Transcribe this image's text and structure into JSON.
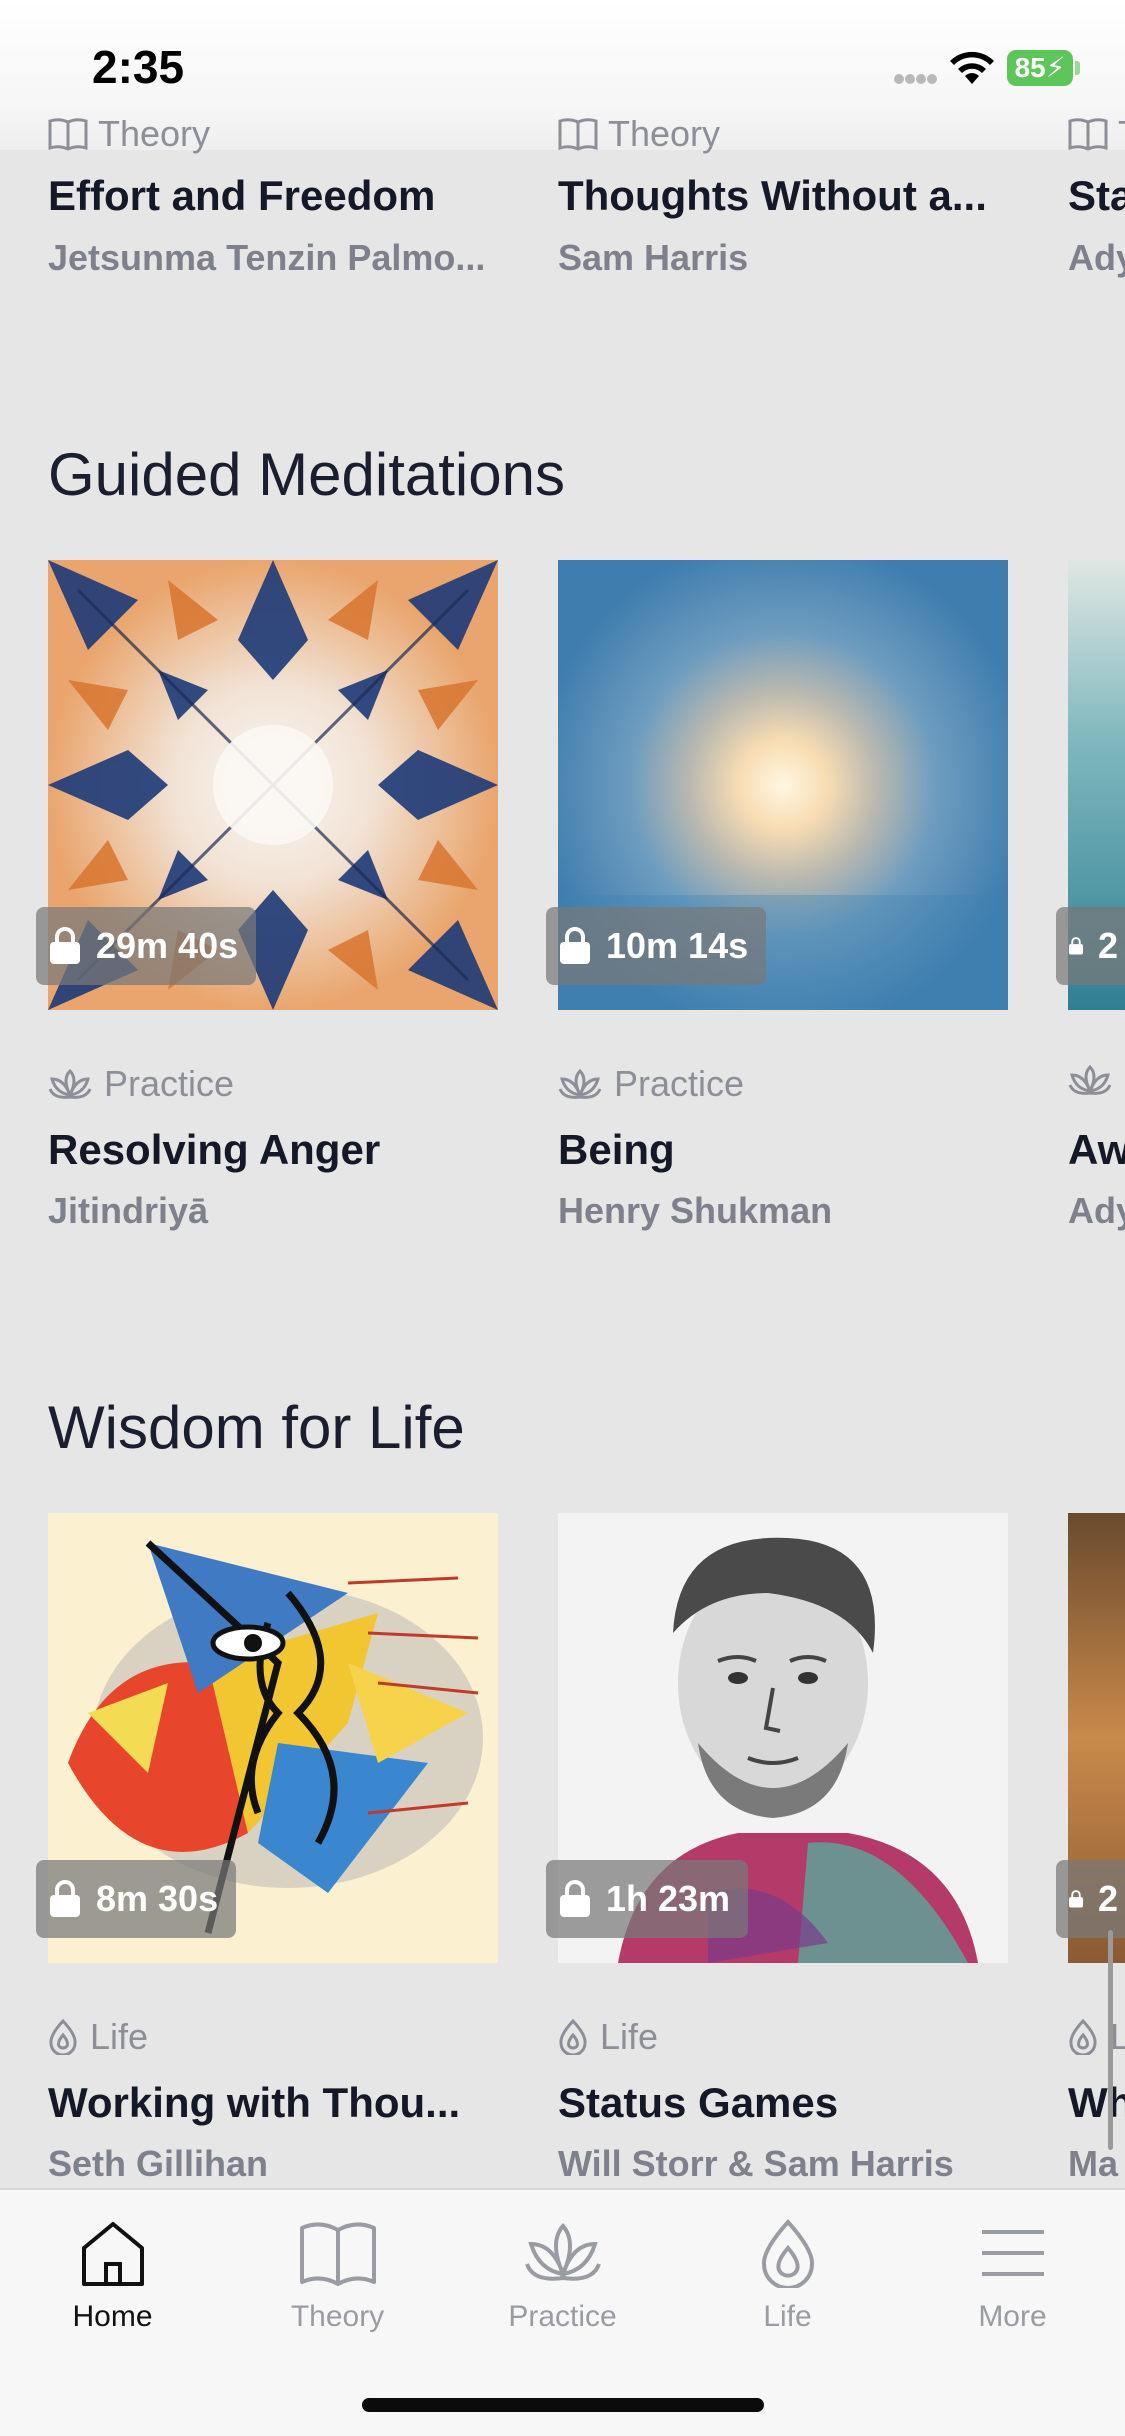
{
  "status_bar": {
    "time": "2:35",
    "battery": "85"
  },
  "top_row": [
    {
      "category": "Theory",
      "title": "Effort and Freedom",
      "author": "Jetsunma Tenzin Palmo..."
    },
    {
      "category": "Theory",
      "title": "Thoughts Without a...",
      "author": "Sam Harris"
    },
    {
      "category": "T",
      "title": "Sta",
      "author": "Ady"
    }
  ],
  "sections": [
    {
      "title": "Guided Meditations",
      "cards": [
        {
          "duration": "29m 40s",
          "category": "Practice",
          "title": "Resolving Anger",
          "author": "Jitindriyā"
        },
        {
          "duration": "10m 14s",
          "category": "Practice",
          "title": "Being",
          "author": "Henry Shukman"
        },
        {
          "duration": "2",
          "category": "",
          "title": "Aw",
          "author": "Ady"
        }
      ]
    },
    {
      "title": "Wisdom for Life",
      "cards": [
        {
          "duration": "8m 30s",
          "category": "Life",
          "title": "Working with Thou...",
          "author": "Seth Gillihan"
        },
        {
          "duration": "1h 23m",
          "category": "Life",
          "title": "Status Games",
          "author": "Will Storr & Sam Harris"
        },
        {
          "duration": "2",
          "category": "L",
          "title": "Wh",
          "author": "Ma"
        }
      ]
    }
  ],
  "tab_bar": [
    {
      "label": "Home",
      "icon": "home-icon",
      "active": true
    },
    {
      "label": "Theory",
      "icon": "book-icon",
      "active": false
    },
    {
      "label": "Practice",
      "icon": "lotus-icon",
      "active": false
    },
    {
      "label": "Life",
      "icon": "drop-icon",
      "active": false
    },
    {
      "label": "More",
      "icon": "menu-icon",
      "active": false
    }
  ],
  "colors": {
    "background": "#e6e6e6",
    "text": "#1a1d2b",
    "muted": "#7e818c",
    "battery": "#5cc65b"
  }
}
